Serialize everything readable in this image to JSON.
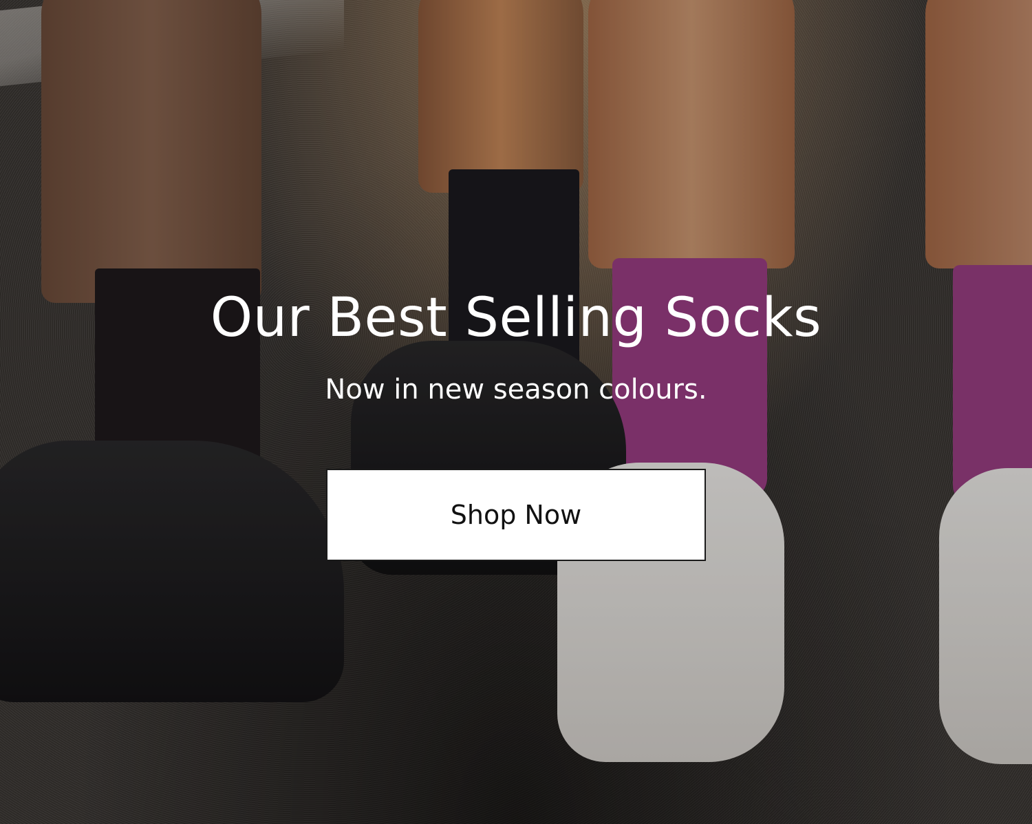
{
  "hero": {
    "headline": "Our Best Selling Socks",
    "subheadline": "Now in new season colours.",
    "cta_label": "Shop Now"
  },
  "colors": {
    "cta_background": "#ffffff",
    "cta_border": "#1a1a1a",
    "text_on_image": "#ffffff",
    "sock_pink": "#9d3e86",
    "sock_black": "#1f1a1d"
  }
}
